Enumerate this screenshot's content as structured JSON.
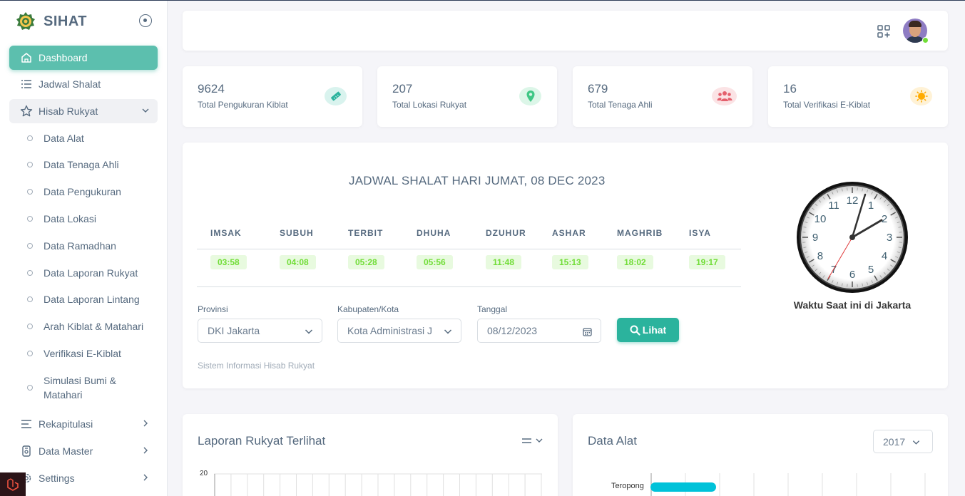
{
  "app": {
    "name": "SIHAT"
  },
  "sidebar": {
    "items": [
      {
        "label": "Dashboard",
        "icon": "home-icon"
      },
      {
        "label": "Jadwal Shalat",
        "icon": "list-icon"
      },
      {
        "label": "Hisab Rukyat",
        "icon": "star-icon",
        "expanded": true
      }
    ],
    "sub_items": [
      {
        "label": "Data Alat"
      },
      {
        "label": "Data Tenaga Ahli"
      },
      {
        "label": "Data Pengukuran"
      },
      {
        "label": "Data Lokasi"
      },
      {
        "label": "Data Ramadhan"
      },
      {
        "label": "Data Laporan Rukyat"
      },
      {
        "label": "Data Laporan Lintang"
      },
      {
        "label": "Arah Kiblat & Matahari"
      },
      {
        "label": "Verifikasi E-Kiblat"
      },
      {
        "label": "Simulasi Bumi & Matahari"
      }
    ],
    "bottom_items": [
      {
        "label": "Rekapitulasi",
        "icon": "menu-icon"
      },
      {
        "label": "Data Master",
        "icon": "database-icon"
      },
      {
        "label": "Settings",
        "icon": "gear-icon"
      }
    ]
  },
  "stats": [
    {
      "value": "9624",
      "label": "Total Pengukuran Kiblat",
      "icon": "ruler-icon",
      "color": "#2bb39d",
      "bg": "#d9f3ee"
    },
    {
      "value": "207",
      "label": "Total Lokasi Rukyat",
      "icon": "map-pin-icon",
      "color": "#3fc785",
      "bg": "#dcf6e8"
    },
    {
      "value": "679",
      "label": "Total Tenaga Ahli",
      "icon": "users-icon",
      "color": "#e4606d",
      "bg": "#fbe3e5"
    },
    {
      "value": "16",
      "label": "Total Verifikasi E-Kiblat",
      "icon": "sun-icon",
      "color": "#ffab00",
      "bg": "#fff2d6"
    }
  ],
  "jadwal": {
    "title": "JADWAL SHALAT HARI JUMAT, 08 DEC 2023",
    "times": [
      {
        "name": "IMSAK",
        "time": "03:58"
      },
      {
        "name": "SUBUH",
        "time": "04:08"
      },
      {
        "name": "TERBIT",
        "time": "05:28"
      },
      {
        "name": "DHUHA",
        "time": "05:56"
      },
      {
        "name": "DZUHUR",
        "time": "11:48"
      },
      {
        "name": "ASHAR",
        "time": "15:13"
      },
      {
        "name": "MAGHRIB",
        "time": "18:02"
      },
      {
        "name": "ISYA",
        "time": "19:17"
      }
    ],
    "form": {
      "provinsi_label": "Provinsi",
      "provinsi_value": "DKI Jakarta",
      "kota_label": "Kabupaten/Kota",
      "kota_value": "Kota Administrasi Jakarta",
      "tanggal_label": "Tanggal",
      "tanggal_value": "08/12/2023",
      "button": "Lihat"
    },
    "footer": "Sistem Informasi Hisab Rukyat",
    "clock_caption": "Waktu Saat ini di Jakarta",
    "clock_numbers": [
      "12",
      "1",
      "2",
      "3",
      "4",
      "5",
      "6",
      "7",
      "8",
      "9",
      "10",
      "11"
    ]
  },
  "laporan_card": {
    "title": "Laporan Rukyat Terlihat",
    "y_tick": "20"
  },
  "alat_card": {
    "title": "Data Alat",
    "year": "2017",
    "bar_label": "Teropong",
    "bar_fraction": 0.24
  },
  "colors": {
    "accent": "#2bb39d",
    "active_menu": "#5cbfae",
    "badge_bg": "#e8fadf",
    "badge_text": "#71dd37"
  }
}
